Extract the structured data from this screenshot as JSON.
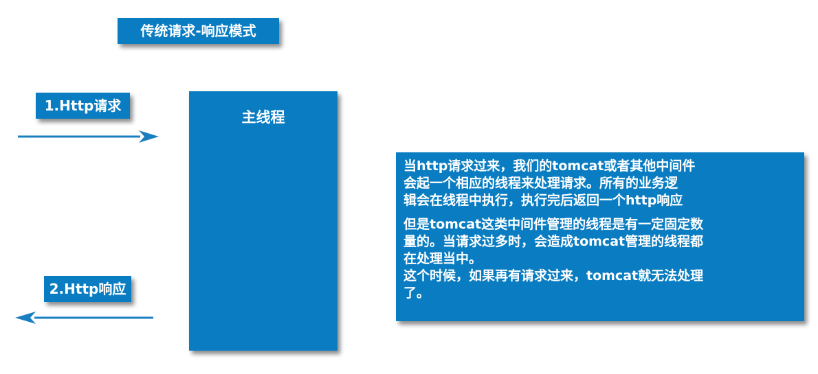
{
  "title": "传统请求-响应模式",
  "request": {
    "label": "1.Http请求"
  },
  "response": {
    "label": "2.Http响应"
  },
  "thread": {
    "label": "主线程"
  },
  "note": {
    "paragraph1": "当http请求过来，我们的tomcat或者其他中间件\n会起一个相应的线程来处理请求。所有的业务逻\n辑会在线程中执行，执行完后返回一个http响应",
    "paragraph2": "但是tomcat这类中间件管理的线程是有一定固定数\n量的。当请求过多时，会造成tomcat管理的线程都\n在处理当中。\n这个时候，如果再有请求过来，tomcat就无法处理\n了。"
  },
  "colors": {
    "box_fill": "#0a7dc2",
    "arrow": "#1a7fc0",
    "text": "#ffffff"
  }
}
